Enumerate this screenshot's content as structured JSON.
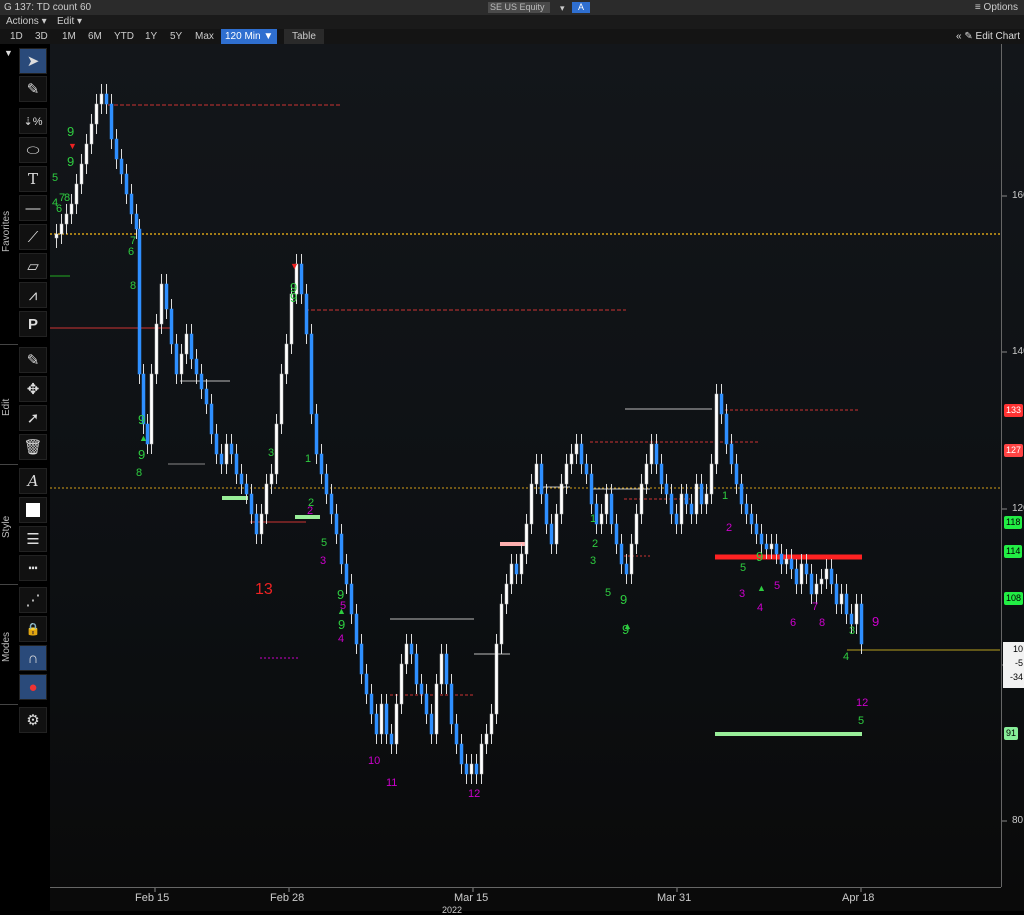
{
  "window": {
    "title": "G 137: TD count 60",
    "security": "SE US Equity",
    "security_badge": "A",
    "options": "≡ Options"
  },
  "menu": {
    "actions": "Actions ▾",
    "edit": "Edit ▾"
  },
  "toolbar": {
    "periods": [
      "1D",
      "3D",
      "1M",
      "6M",
      "YTD",
      "1Y",
      "5Y",
      "Max"
    ],
    "interval": "120 Min ▼",
    "table": "Table",
    "edit_chart": "✎ Edit Chart",
    "collapse": "«"
  },
  "side_groups": {
    "favorites": "Favorites",
    "edit": "Edit",
    "style": "Style",
    "modes": "Modes"
  },
  "axes": {
    "y_ticks": [
      "160",
      "140",
      "120",
      "100",
      "80"
    ],
    "x_ticks": [
      "Feb 15",
      "Feb 28",
      "Mar 15",
      "Mar 31",
      "Apr 18"
    ],
    "year": "2022"
  },
  "price_tags": [
    {
      "text": "133",
      "color": "#ff3333"
    },
    {
      "text": "127",
      "color": "#ff4444"
    },
    {
      "text": "118",
      "color": "#22ee44"
    },
    {
      "text": "114",
      "color": "#22ee44"
    },
    {
      "text": "108",
      "color": "#22ee44"
    },
    {
      "text": "91",
      "color": "#88ee99"
    }
  ],
  "last_price_box": {
    "lines": [
      "10",
      "-5",
      "-34"
    ]
  },
  "counts": [
    {
      "t": "9",
      "c": "#2ecc40"
    },
    {
      "t": "9",
      "c": "#2ecc40"
    },
    {
      "t": "5",
      "c": "#2ecc40"
    },
    {
      "t": "7",
      "c": "#2ecc40"
    },
    {
      "t": "8",
      "c": "#2ecc40"
    },
    {
      "t": "4",
      "c": "#2ecc40"
    },
    {
      "t": "6",
      "c": "#2ecc40"
    },
    {
      "t": "7",
      "c": "#2ecc40"
    },
    {
      "t": "6",
      "c": "#2ecc40"
    },
    {
      "t": "8",
      "c": "#2ecc40"
    },
    {
      "t": "9",
      "c": "#2ecc40"
    },
    {
      "t": "9",
      "c": "#2ecc40"
    },
    {
      "t": "9",
      "c": "#2ecc40"
    },
    {
      "t": "9",
      "c": "#2ecc40"
    },
    {
      "t": "8",
      "c": "#2ecc40"
    },
    {
      "t": "13",
      "c": "#e22"
    },
    {
      "t": "1",
      "c": "#2ecc40"
    },
    {
      "t": "2",
      "c": "#2ecc40"
    },
    {
      "t": "3",
      "c": "#2ecc40"
    },
    {
      "t": "5",
      "c": "#2ecc40"
    },
    {
      "t": "9",
      "c": "#2ecc40"
    },
    {
      "t": "9",
      "c": "#2ecc40"
    },
    {
      "t": "2",
      "c": "#c0c"
    },
    {
      "t": "3",
      "c": "#c0c"
    },
    {
      "t": "5",
      "c": "#c0c"
    },
    {
      "t": "4",
      "c": "#c0c"
    },
    {
      "t": "10",
      "c": "#c0c"
    },
    {
      "t": "11",
      "c": "#c0c"
    },
    {
      "t": "12",
      "c": "#c0c"
    },
    {
      "t": "1",
      "c": "#2ecc40"
    },
    {
      "t": "2",
      "c": "#2ecc40"
    },
    {
      "t": "3",
      "c": "#2ecc40"
    },
    {
      "t": "5",
      "c": "#2ecc40"
    },
    {
      "t": "9",
      "c": "#2ecc40"
    },
    {
      "t": "9",
      "c": "#2ecc40"
    },
    {
      "t": "1",
      "c": "#2ecc40"
    },
    {
      "t": "2",
      "c": "#c0c"
    },
    {
      "t": "5",
      "c": "#2ecc40"
    },
    {
      "t": "9",
      "c": "#2ecc40"
    },
    {
      "t": "3",
      "c": "#c0c"
    },
    {
      "t": "4",
      "c": "#c0c"
    },
    {
      "t": "5",
      "c": "#c0c"
    },
    {
      "t": "6",
      "c": "#c0c"
    },
    {
      "t": "7",
      "c": "#c0c"
    },
    {
      "t": "8",
      "c": "#c0c"
    },
    {
      "t": "9",
      "c": "#c0c"
    },
    {
      "t": "3",
      "c": "#2ecc40"
    },
    {
      "t": "4",
      "c": "#2ecc40"
    },
    {
      "t": "12",
      "c": "#c0c"
    },
    {
      "t": "5",
      "c": "#2ecc40"
    }
  ],
  "colors": {
    "up": "#ffffff",
    "down": "#2f8fff",
    "buy": "#2ecc40",
    "sell": "#ff3333",
    "count": "#cc33cc",
    "level": "#d4a017"
  }
}
